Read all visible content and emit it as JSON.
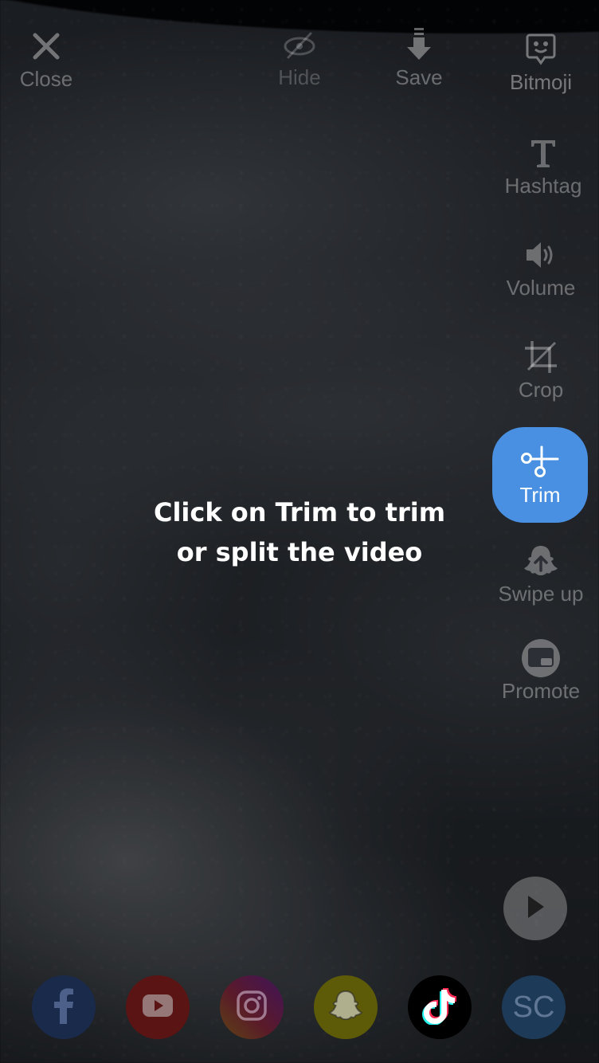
{
  "top_bar": {
    "close_label": "Close",
    "hide_label": "Hide",
    "save_label": "Save",
    "bitmoji_label": "Bitmoji"
  },
  "side_tools": {
    "hashtag_label": "Hashtag",
    "volume_label": "Volume",
    "crop_label": "Crop",
    "trim_label": "Trim",
    "swipe_up_label": "Swipe up",
    "promote_label": "Promote"
  },
  "hint": {
    "line1": "Click on Trim to trim",
    "line2": "or split the video"
  },
  "share": {
    "items": [
      {
        "name": "facebook",
        "icon": "facebook-icon"
      },
      {
        "name": "youtube",
        "icon": "youtube-icon"
      },
      {
        "name": "instagram",
        "icon": "instagram-icon"
      },
      {
        "name": "snapchat",
        "icon": "snapchat-icon"
      },
      {
        "name": "tiktok",
        "icon": "tiktok-icon"
      },
      {
        "name": "soundcloud",
        "icon": "sc-icon",
        "label": "SC"
      }
    ]
  },
  "colors": {
    "accent": "#4a90e2",
    "dim_overlay": "rgba(0,0,0,0.55)",
    "facebook": "#1a2a4a",
    "youtube": "#5a1414",
    "snapchat": "#5e5b08",
    "tiktok": "#000000",
    "soundcloud": "#1d3a58"
  }
}
